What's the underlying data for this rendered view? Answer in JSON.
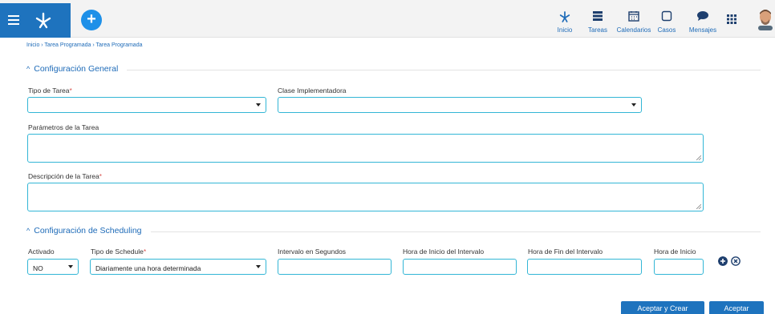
{
  "header": {
    "nav": [
      {
        "label": "Inicio",
        "icon": "tree-icon"
      },
      {
        "label": "Tareas",
        "icon": "tasks-icon"
      },
      {
        "label": "Calendarios",
        "icon": "calendar-icon"
      },
      {
        "label": "Casos",
        "icon": "case-icon"
      },
      {
        "label": "Mensajes",
        "icon": "chat-icon"
      }
    ],
    "accent": "#1e73be"
  },
  "breadcrumb": "Inicio › Tarea Programada › Tarea Programada",
  "general": {
    "title": "Configuración General",
    "tipo_tarea_label": "Tipo de Tarea",
    "tipo_tarea_value": "",
    "clase_label": "Clase Implementadora",
    "clase_value": "",
    "parametros_label": "Parámetros de la Tarea",
    "descripcion_label": "Descripción de la Tarea",
    "required_mark": "*"
  },
  "scheduling": {
    "title": "Configuración de Scheduling",
    "activado_label": "Activado",
    "activado_value": "NO",
    "tipo_schedule_label": "Tipo de Schedule",
    "tipo_schedule_value": "Diariamente una hora determinada",
    "intervalo_label": "Intervalo en Segundos",
    "hora_inicio_intervalo_label": "Hora de Inicio del Intervalo",
    "hora_fin_intervalo_label": "Hora de Fin del Intervalo",
    "hora_inicio_label": "Hora de Inicio"
  },
  "actions": {
    "accept_create": "Aceptar y Crear",
    "accept": "Aceptar"
  }
}
